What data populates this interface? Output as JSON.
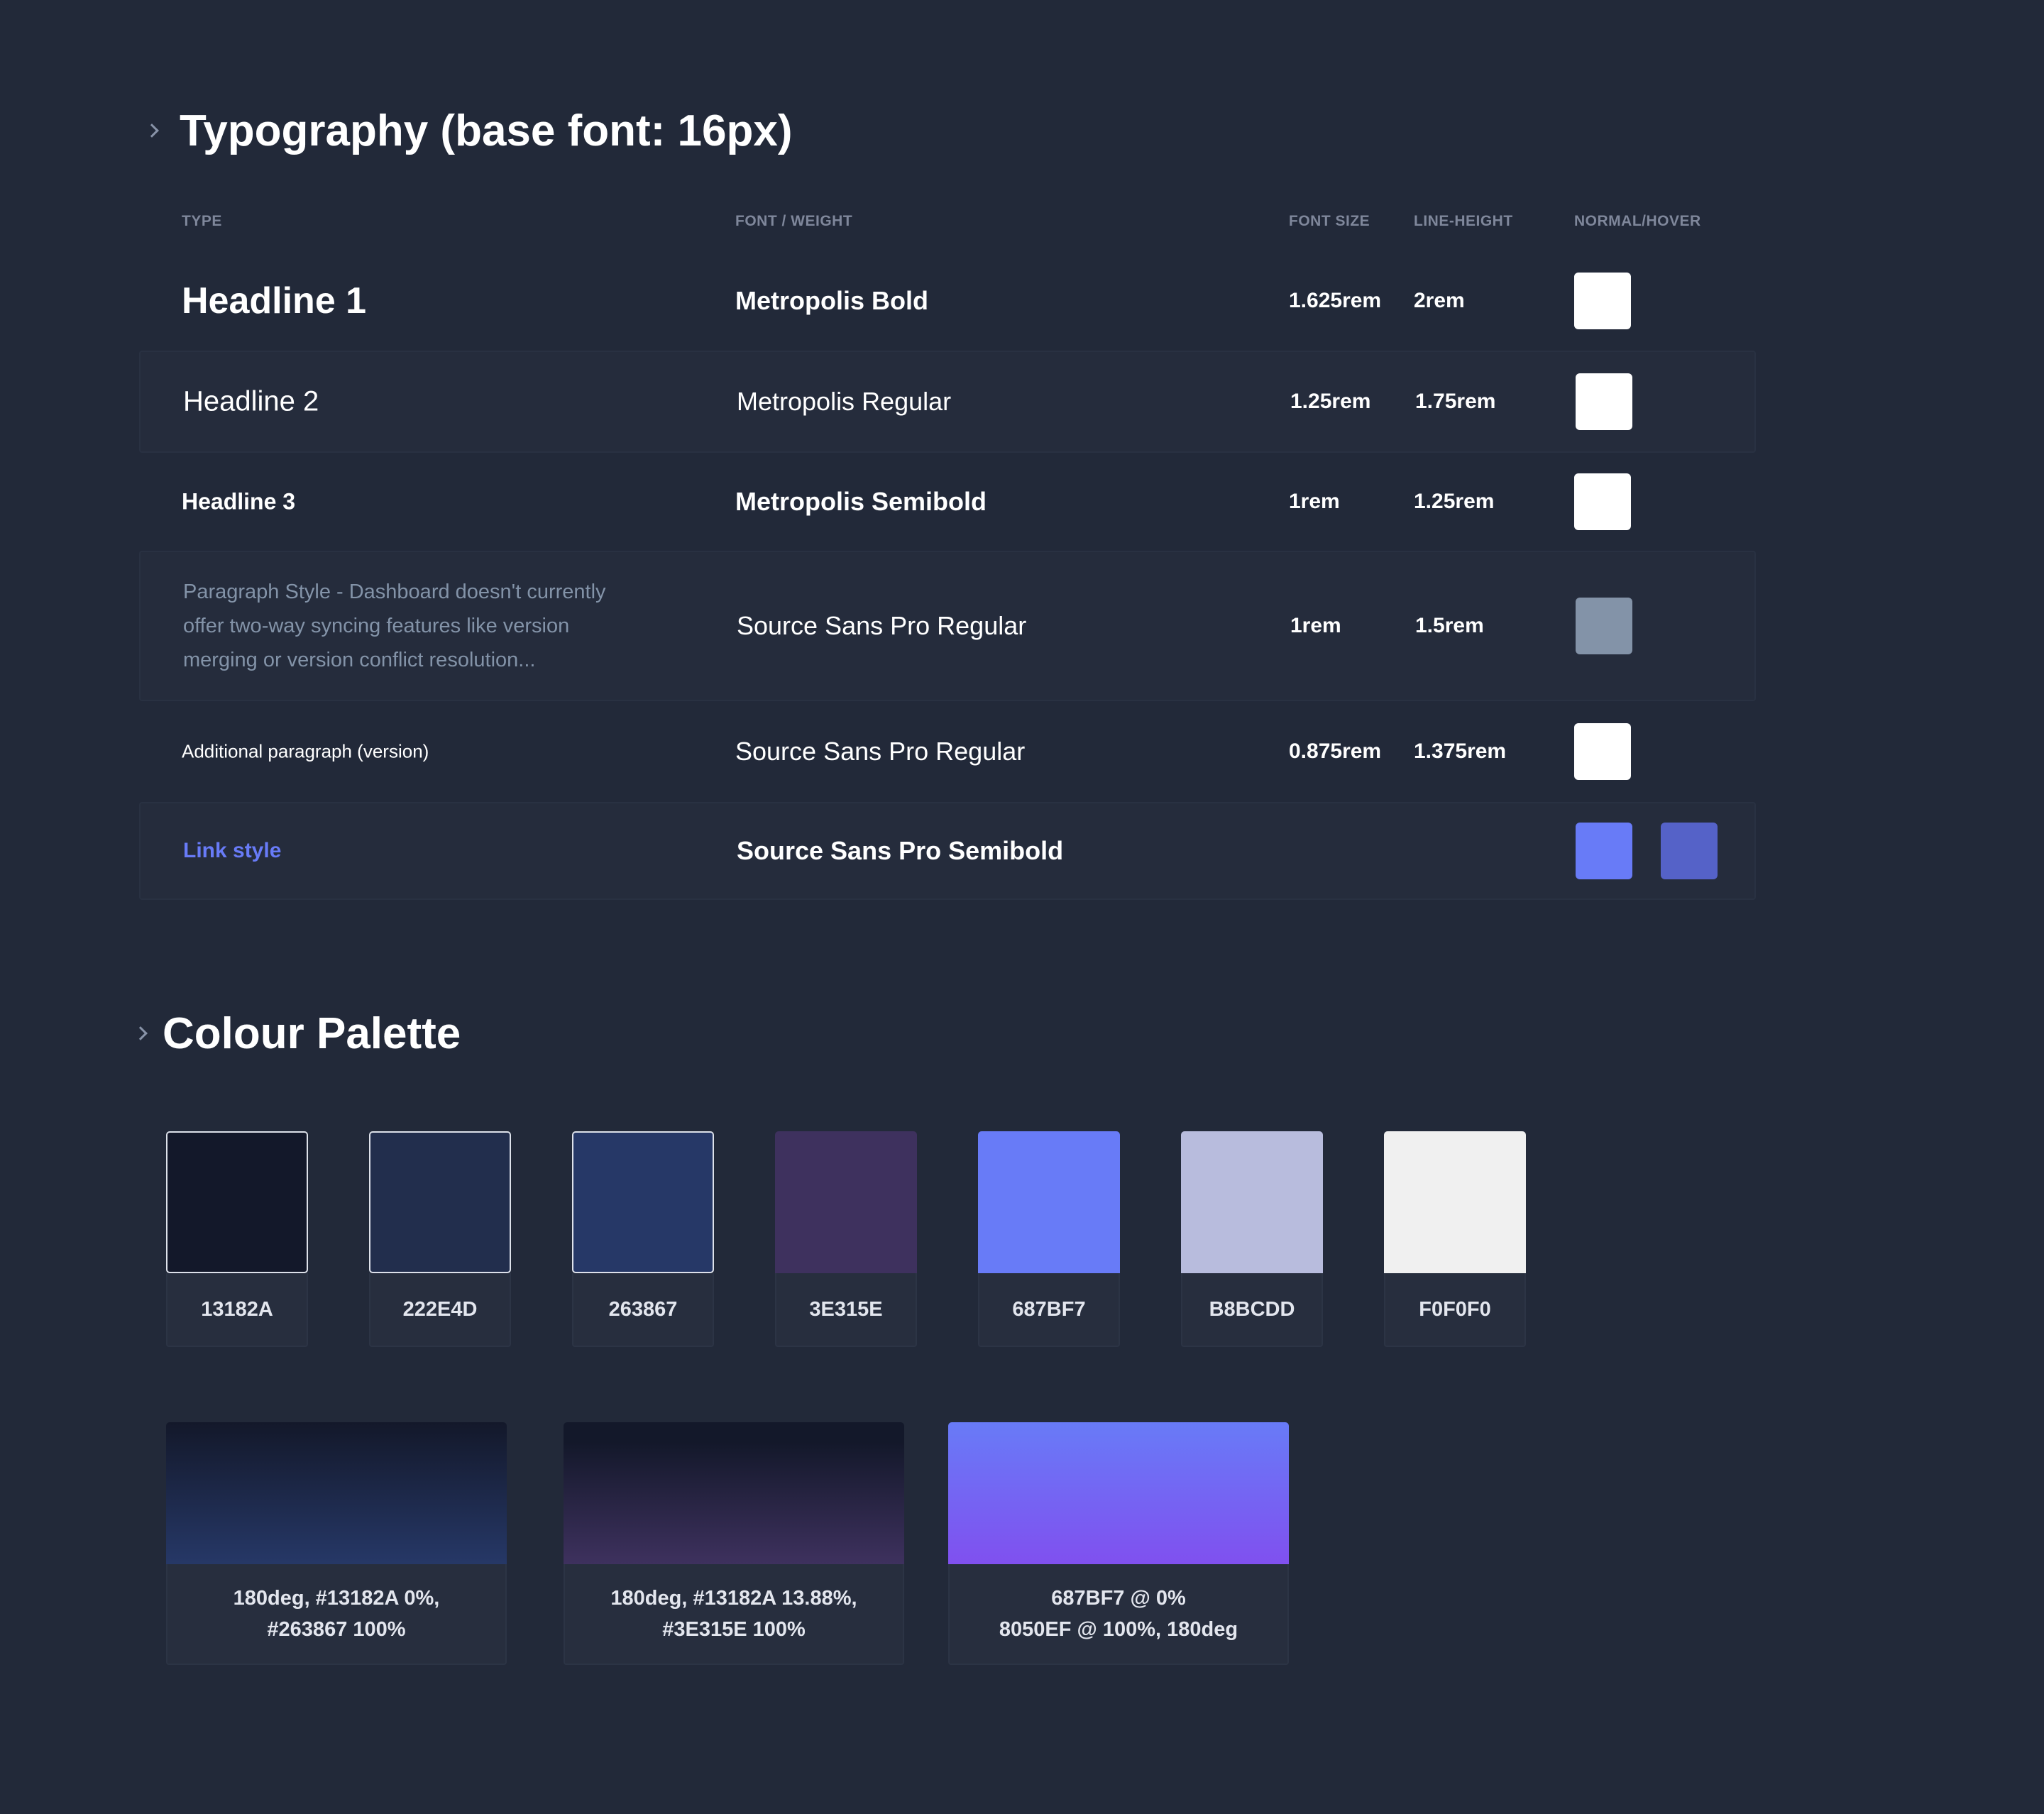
{
  "typography": {
    "heading": "Typography (base font: 16px)",
    "columns": {
      "type": "TYPE",
      "font_weight": "FONT / WEIGHT",
      "font_size": "FONT SIZE",
      "line_height": "LINE-HEIGHT",
      "normal_hover": "NORMAL/HOVER"
    },
    "rows": [
      {
        "type": "Headline 1",
        "font": "Metropolis Bold",
        "size": "1.625rem",
        "line_height": "2rem",
        "normal_color": "#FFFFFF"
      },
      {
        "type": "Headline 2",
        "font": "Metropolis Regular",
        "size": "1.25rem",
        "line_height": "1.75rem",
        "normal_color": "#FFFFFF"
      },
      {
        "type": "Headline 3",
        "font": "Metropolis Semibold",
        "size": "1rem",
        "line_height": "1.25rem",
        "normal_color": "#FFFFFF"
      },
      {
        "type_lines": [
          "Paragraph Style - Dashboard doesn't currently",
          "offer two-way syncing features like version",
          "merging or version conflict resolution..."
        ],
        "font": "Source Sans Pro Regular",
        "size": "1rem",
        "line_height": "1.5rem",
        "normal_color": "#8393A8"
      },
      {
        "type": "Additional paragraph (version)",
        "font": "Source Sans Pro Regular",
        "size": "0.875rem",
        "line_height": "1.375rem",
        "normal_color": "#FFFFFF"
      },
      {
        "type": "Link style",
        "font": "Source Sans Pro Semibold",
        "size": "",
        "line_height": "",
        "normal_color": "#687BF7",
        "hover_color": "#5562C8"
      }
    ]
  },
  "palette": {
    "heading": "Colour Palette",
    "colors": [
      {
        "hex": "#13182A",
        "label": "13182A",
        "outlined": true
      },
      {
        "hex": "#222E4D",
        "label": "222E4D",
        "outlined": true
      },
      {
        "hex": "#263867",
        "label": "263867",
        "outlined": true
      },
      {
        "hex": "#3E315E",
        "label": "3E315E",
        "outlined": false
      },
      {
        "hex": "#687BF7",
        "label": "687BF7",
        "outlined": false
      },
      {
        "hex": "#B8BCDD",
        "label": "B8BCDD",
        "outlined": false
      },
      {
        "hex": "#F0F0F0",
        "label": "F0F0F0",
        "outlined": false
      }
    ],
    "gradients": [
      {
        "css": "linear-gradient(180deg, #13182A 0%, #263867 100%)",
        "label_lines": [
          "180deg, #13182A 0%,",
          "#263867 100%"
        ]
      },
      {
        "css": "linear-gradient(180deg, #13182A 13.88%, #3E315E 100%)",
        "label_lines": [
          "180deg, #13182A 13.88%,",
          "#3E315E 100%"
        ]
      },
      {
        "css": "linear-gradient(180deg, #687BF7 0%, #8050EF 100%)",
        "label_lines": [
          "687BF7 @ 0%",
          "8050EF @ 100%, 180deg"
        ]
      }
    ]
  }
}
